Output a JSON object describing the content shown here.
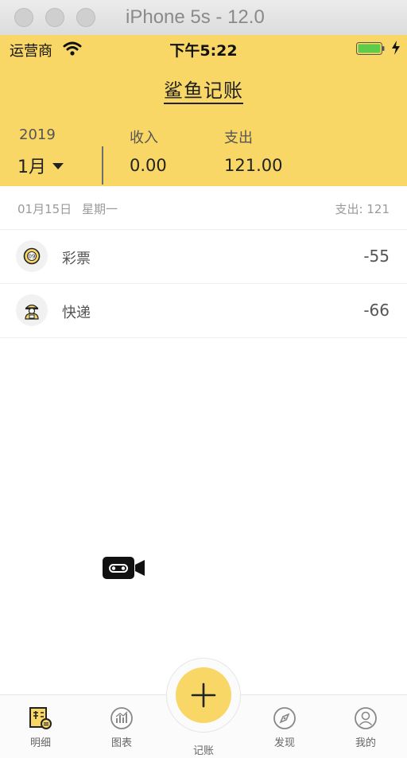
{
  "window": {
    "title": "iPhone 5s - 12.0"
  },
  "status_bar": {
    "carrier": "运营商",
    "time": "下午5:22"
  },
  "header": {
    "app_title": "鲨鱼记账",
    "year": "2019",
    "month": "1月",
    "income_label": "收入",
    "income_value": "0.00",
    "expense_label": "支出",
    "expense_value": "121.00"
  },
  "day_group": {
    "date": "01月15日",
    "weekday": "星期一",
    "total": "支出: 121"
  },
  "records": [
    {
      "name": "彩票",
      "amount": "-55",
      "icon": "lottery-ball-icon"
    },
    {
      "name": "快递",
      "amount": "-66",
      "icon": "courier-icon"
    }
  ],
  "tabbar": {
    "items": [
      {
        "label": "明细",
        "icon": "ledger-icon",
        "selected": true
      },
      {
        "label": "图表",
        "icon": "chart-icon"
      },
      {
        "label": "记账",
        "icon": "plus-icon"
      },
      {
        "label": "发现",
        "icon": "compass-icon"
      },
      {
        "label": "我的",
        "icon": "profile-icon"
      }
    ]
  },
  "colors": {
    "accent": "#f8d766",
    "text": "#333333",
    "muted": "#9a9a9a"
  }
}
